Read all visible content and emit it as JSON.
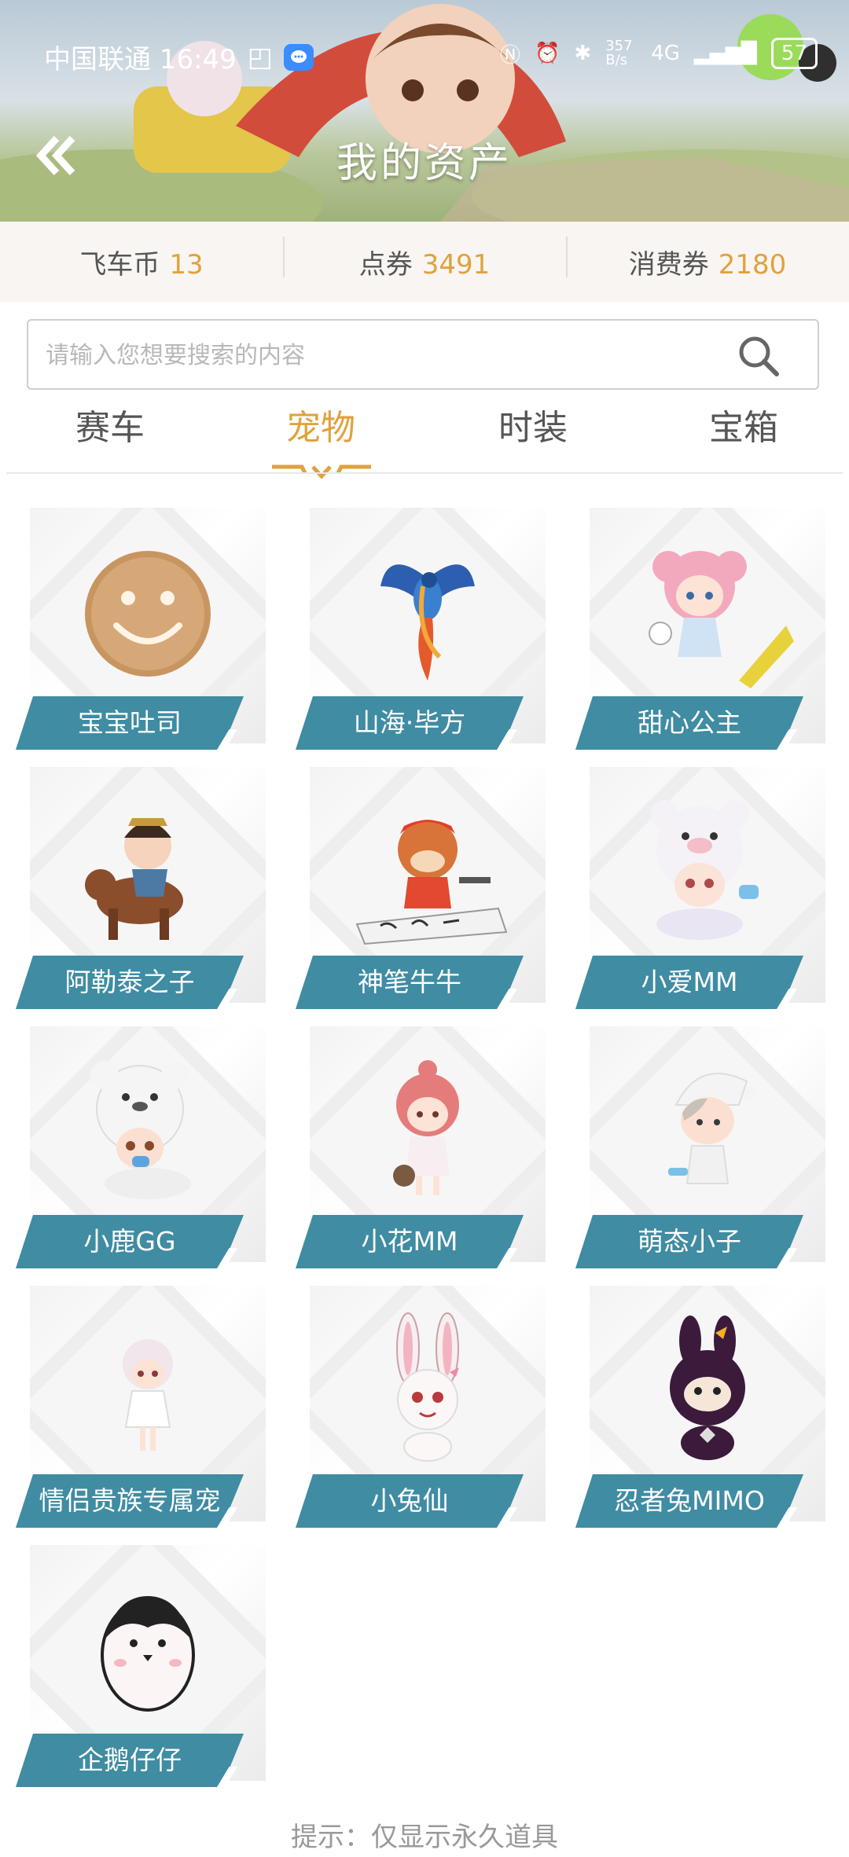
{
  "status_bar": {
    "carrier_time": "中国联通 16:49",
    "network_speed": "357 B/s",
    "network_type": "4G",
    "battery": "57"
  },
  "header": {
    "title": "我的资产"
  },
  "currency": [
    {
      "label": "飞车币",
      "value": "13"
    },
    {
      "label": "点券",
      "value": "3491"
    },
    {
      "label": "消费券",
      "value": "2180"
    }
  ],
  "search": {
    "placeholder": "请输入您想要搜索的内容",
    "value": ""
  },
  "tabs": [
    {
      "label": "赛车",
      "active": false
    },
    {
      "label": "宠物",
      "active": true
    },
    {
      "label": "时装",
      "active": false
    },
    {
      "label": "宝箱",
      "active": false
    }
  ],
  "pets": [
    {
      "name": "宝宝吐司",
      "icon": "cookie-face-icon"
    },
    {
      "name": "山海·毕方",
      "icon": "phoenix-bird-icon"
    },
    {
      "name": "甜心公主",
      "icon": "pink-hair-girl-icon"
    },
    {
      "name": "阿勒泰之子",
      "icon": "horse-rider-icon"
    },
    {
      "name": "神笔牛牛",
      "icon": "calligraphy-calf-icon"
    },
    {
      "name": "小爱MM",
      "icon": "bear-hood-girl-icon"
    },
    {
      "name": "小鹿GG",
      "icon": "bear-hood-baby-icon"
    },
    {
      "name": "小花MM",
      "icon": "red-hair-girl-icon"
    },
    {
      "name": "萌态小子",
      "icon": "nightcap-boy-icon"
    },
    {
      "name": "情侣贵族专属宠",
      "icon": "white-dress-girl-icon"
    },
    {
      "name": "小兔仙",
      "icon": "white-rabbit-icon"
    },
    {
      "name": "忍者兔MIMO",
      "icon": "ninja-rabbit-icon"
    },
    {
      "name": "企鹅仔仔",
      "icon": "penguin-icon"
    }
  ],
  "footer": {
    "tip": "提示：仅显示永久道具"
  },
  "colors": {
    "accent": "#e0a23c",
    "label_bg": "#3f8ca3",
    "currency_bg": "#f8f5f2"
  }
}
